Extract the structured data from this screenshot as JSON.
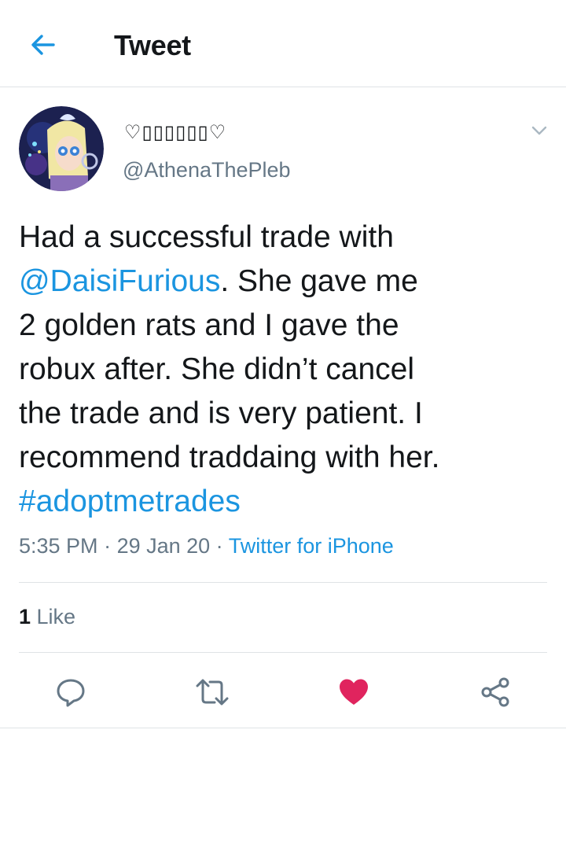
{
  "header": {
    "title": "Tweet"
  },
  "tweet": {
    "display_name": "♡▯▯▯▯▯▯♡",
    "handle": "@AthenaThePleb",
    "text_lines": [
      {
        "before": "Had a successful trade with",
        "link": "",
        "after": ""
      },
      {
        "before": "",
        "link": "@DaisiFurious",
        "after": ". She gave me"
      },
      {
        "before": "2 golden rats and I gave the",
        "link": "",
        "after": ""
      },
      {
        "before": "robux after. She didn’t cancel",
        "link": "",
        "after": ""
      },
      {
        "before": "the trade and is very patient. I",
        "link": "",
        "after": ""
      },
      {
        "before": "recommend traddaing with her.",
        "link": "",
        "after": ""
      },
      {
        "before": "",
        "link": "#adoptmetrades",
        "after": ""
      }
    ],
    "time": "5:35 PM",
    "separator": " · ",
    "date": "29 Jan 20",
    "source": "Twitter for iPhone",
    "like_count": "1",
    "like_label": " Like"
  },
  "actions": [
    {
      "name": "reply",
      "icon": "reply-icon"
    },
    {
      "name": "retweet",
      "icon": "retweet-icon"
    },
    {
      "name": "like",
      "icon": "heart-icon",
      "active": true
    },
    {
      "name": "share",
      "icon": "share-icon"
    }
  ],
  "colors": {
    "accent": "#1b95e0",
    "muted": "#657786",
    "like_active": "#e0245e",
    "icon_gray": "#657786"
  }
}
